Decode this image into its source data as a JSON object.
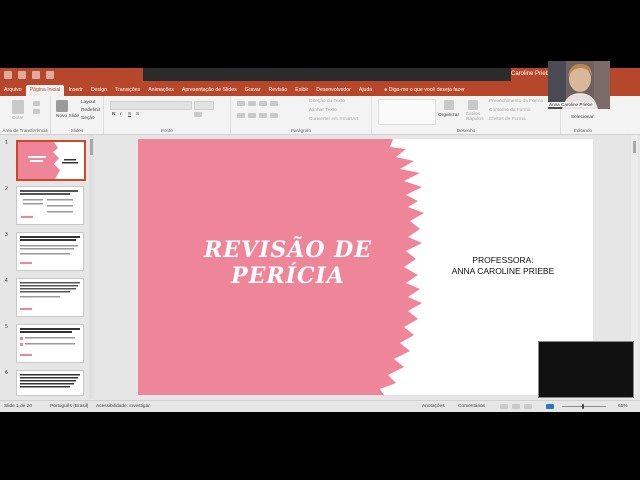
{
  "titlebar": {
    "user_name": "Caroline Priebe"
  },
  "tabs": [
    "Arquivo",
    "Página Inicial",
    "Inserir",
    "Design",
    "Transições",
    "Animações",
    "Apresentação de Slides",
    "Gravar",
    "Revisão",
    "Exibir",
    "Desenvolvedor",
    "Ajuda"
  ],
  "active_tab": "Página Inicial",
  "tell_me": "Diga-me o que você deseja fazer",
  "ribbon": {
    "clipboard": {
      "label": "Área de Transferência",
      "paste": "Colar"
    },
    "slides": {
      "label": "Slides",
      "new_slide": "Novo Slide",
      "layout": "Layout",
      "reset": "Redefinir",
      "section": "Seção"
    },
    "font": {
      "label": "Fonte"
    },
    "paragraph": {
      "label": "Parágrafo",
      "text_direction": "Direção do Texto",
      "align_text": "Alinhar Texto",
      "smartart": "Converter em SmartArt"
    },
    "drawing": {
      "label": "Desenho",
      "arrange": "Organizar",
      "quick_styles": "Estilos Rápidos",
      "shape_fill": "Preenchimento da Forma",
      "shape_outline": "Contorno da Forma",
      "shape_effects": "Efeitos de Forma"
    },
    "editing": {
      "label": "Editando",
      "select": "Selecionar"
    }
  },
  "slide_numbers": [
    "1",
    "2",
    "3",
    "4",
    "5",
    "6"
  ],
  "slide": {
    "title_line1": "REVISÃO DE",
    "title_line2": "PERÍCIA",
    "prof_line1": "PROFESSORA:",
    "prof_line2": "ANNA CAROLINE PRIEBE",
    "accent_color": "#ee8599"
  },
  "status": {
    "slide_count": "Slide 1 de 20",
    "language": "Português (Brasil)",
    "accessibility": "Acessibilidade: investigar",
    "notes": "Anotações",
    "comments": "Comentários",
    "zoom": "65%"
  },
  "webcam": {
    "name": "Anna Caroline Priebe"
  }
}
